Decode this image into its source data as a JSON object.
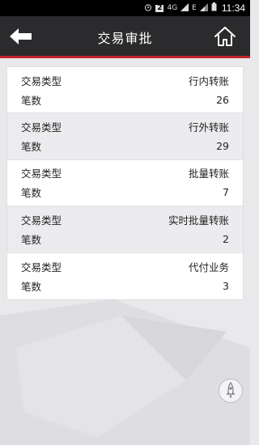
{
  "status_bar": {
    "time": "11:34",
    "network_badge": "2",
    "network_type": "4G",
    "network_type_alt": "E",
    "icons": [
      "alarm-icon",
      "sim-badge-icon",
      "signal-icon",
      "wifi-signal-icon",
      "battery-icon"
    ]
  },
  "header": {
    "title": "交易审批",
    "back_icon": "back-arrow-icon",
    "home_icon": "home-icon"
  },
  "accent_color": "#c4262e",
  "records": [
    {
      "type_label": "交易类型",
      "type_value": "行内转账",
      "count_label": "笔数",
      "count_value": "26"
    },
    {
      "type_label": "交易类型",
      "type_value": "行外转账",
      "count_label": "笔数",
      "count_value": "29"
    },
    {
      "type_label": "交易类型",
      "type_value": "批量转账",
      "count_label": "笔数",
      "count_value": "7"
    },
    {
      "type_label": "交易类型",
      "type_value": "实时批量转账",
      "count_label": "笔数",
      "count_value": "2"
    },
    {
      "type_label": "交易类型",
      "type_value": "代付业务",
      "count_label": "笔数",
      "count_value": "3"
    }
  ],
  "floating_button_icon": "rocket-icon"
}
